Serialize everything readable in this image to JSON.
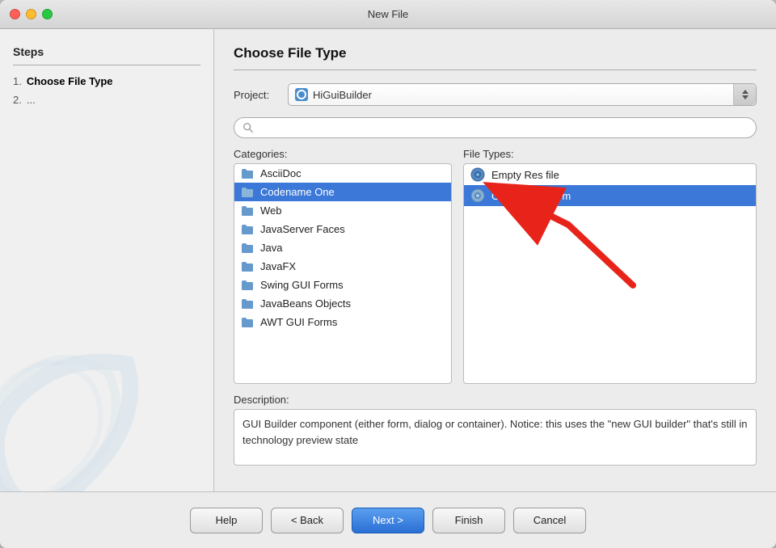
{
  "window": {
    "title": "New File"
  },
  "steps": {
    "heading": "Steps",
    "items": [
      {
        "number": "1.",
        "label": "Choose File Type",
        "active": true
      },
      {
        "number": "2.",
        "label": "...",
        "active": false
      }
    ]
  },
  "main": {
    "panel_title": "Choose File Type",
    "project_label": "Project:",
    "project_value": "HiGuiBuilder",
    "search_placeholder": "Q",
    "categories_label": "Categories:",
    "categories": [
      {
        "label": "AsciiDoc",
        "selected": false
      },
      {
        "label": "Codename One",
        "selected": false
      },
      {
        "label": "Web",
        "selected": false
      },
      {
        "label": "JavaServer Faces",
        "selected": false
      },
      {
        "label": "Java",
        "selected": false
      },
      {
        "label": "JavaFX",
        "selected": false
      },
      {
        "label": "Swing GUI Forms",
        "selected": false
      },
      {
        "label": "JavaBeans Objects",
        "selected": false
      },
      {
        "label": "AWT GUI Forms",
        "selected": false
      }
    ],
    "filetypes_label": "File Types:",
    "filetypes": [
      {
        "label": "Empty Res file",
        "selected": false
      },
      {
        "label": "Gui Builder Form",
        "selected": true
      }
    ],
    "description_label": "Description:",
    "description_text": "GUI Builder component (either form, dialog or container). Notice: this uses the \"new GUI builder\" that's still in technology preview state"
  },
  "footer": {
    "help_label": "Help",
    "back_label": "< Back",
    "next_label": "Next >",
    "finish_label": "Finish",
    "cancel_label": "Cancel"
  }
}
